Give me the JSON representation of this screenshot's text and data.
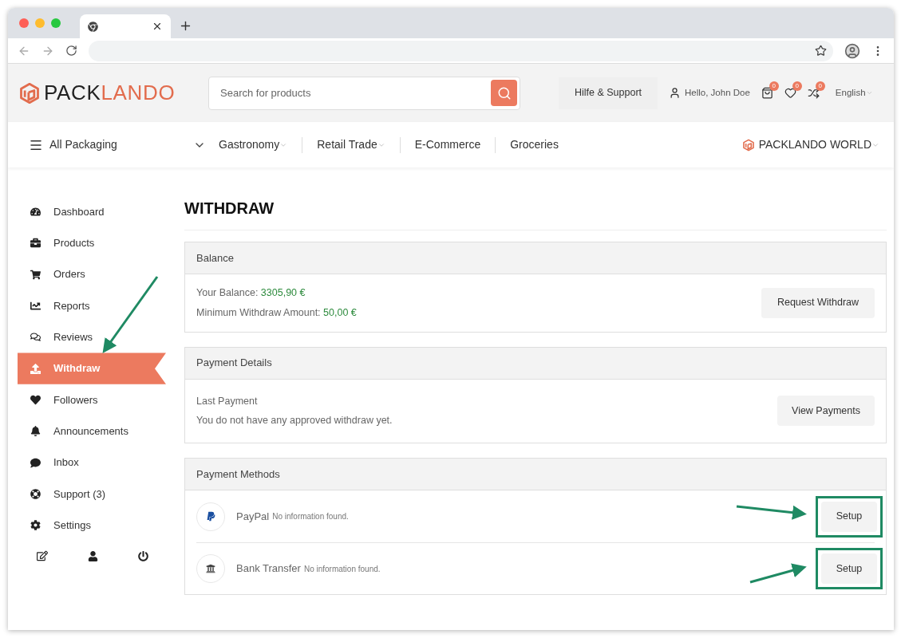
{
  "header": {
    "logo": {
      "part_1": "PACK",
      "part_2": "LANDO"
    },
    "search": {
      "placeholder": "Search for products"
    },
    "support": "Hilfe & Support",
    "greeting": "Hello, John Doe",
    "counters": [
      {
        "count": "0"
      },
      {
        "count": "0"
      },
      {
        "count": "0"
      }
    ],
    "language": "English"
  },
  "nav": {
    "all": "All Packaging",
    "categories": [
      {
        "label": "Gastronomy",
        "dropdown": true
      },
      {
        "label": "Retail Trade",
        "dropdown": true
      },
      {
        "label": "E-Commerce",
        "dropdown": false
      },
      {
        "label": "Groceries",
        "dropdown": false
      }
    ],
    "world": "PACKLANDO WORLD"
  },
  "sidebar": {
    "items": [
      {
        "label": "Dashboard",
        "selected": false
      },
      {
        "label": "Products",
        "selected": false
      },
      {
        "label": "Orders",
        "selected": false
      },
      {
        "label": "Reports",
        "selected": false
      },
      {
        "label": "Reviews",
        "selected": false
      },
      {
        "label": "Withdraw",
        "selected": true
      },
      {
        "label": "Followers",
        "selected": false
      },
      {
        "label": "Announcements",
        "selected": false
      },
      {
        "label": "Inbox",
        "selected": false
      },
      {
        "label": "Support (3)",
        "selected": false
      },
      {
        "label": "Settings",
        "selected": false
      }
    ]
  },
  "page_title": "WITHDRAW",
  "balance": {
    "title": "Balance",
    "lines": [
      {
        "label": "Your Balance:",
        "value": "3305,90 €"
      },
      {
        "label": "Minimum Withdraw Amount:",
        "value": "50,00 €"
      }
    ],
    "button": "Request Withdraw"
  },
  "payment_details": {
    "title": "Payment Details",
    "label": "Last Payment",
    "text": "You do not have any approved withdraw yet.",
    "button": "View Payments"
  },
  "payment_methods": {
    "title": "Payment Methods",
    "methods": [
      {
        "kind": "paypal",
        "name": "PayPal",
        "note": "No information found.",
        "button": "Setup",
        "highlighted": true
      },
      {
        "kind": "bank",
        "name": "Bank Transfer",
        "note": "No information found.",
        "button": "Setup",
        "highlighted": true
      }
    ]
  }
}
